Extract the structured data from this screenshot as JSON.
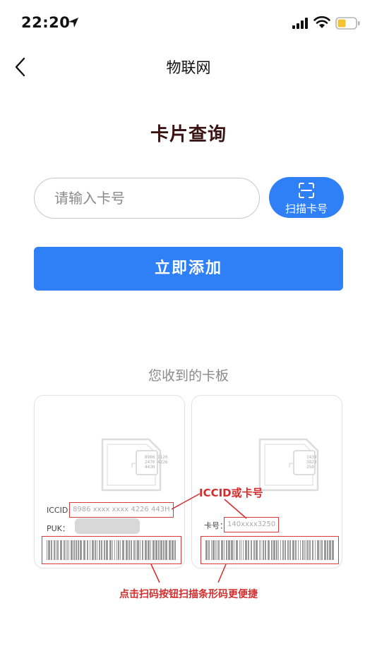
{
  "status_bar": {
    "time": "22:20"
  },
  "nav": {
    "title": "物联网"
  },
  "heading": "卡片查询",
  "input": {
    "placeholder": "请输入卡号",
    "value": ""
  },
  "scan_button": {
    "label": "扫描卡号"
  },
  "add_button": {
    "label": "立即添加"
  },
  "section_label": "您收到的卡板",
  "card_left": {
    "chip_lines": [
      "8986 1120",
      "2470 4226",
      "443H"
    ],
    "iccid_label": "ICCID:",
    "iccid_value": "8986 xxxx xxxx 4226 443H",
    "puk_label": "PUK："
  },
  "card_right": {
    "chip_lines": [
      "1439",
      "3823",
      "250"
    ],
    "number_label": "卡号：",
    "number_value": "140xxxx3250"
  },
  "annotations": {
    "top": "ICCID或卡号",
    "bottom": "点击扫码按钮扫描条形码更便捷"
  },
  "colors": {
    "accent": "#2f80f7",
    "annotation": "#d62c2c",
    "heading": "#3a1414"
  }
}
